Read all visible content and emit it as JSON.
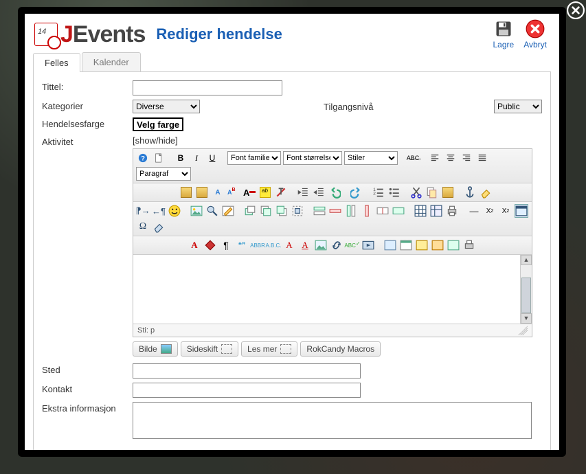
{
  "logo": {
    "j": "J",
    "rest": "Events"
  },
  "page_title": "Rediger hendelse",
  "header_actions": {
    "save": "Lagre",
    "cancel": "Avbryt"
  },
  "tabs": {
    "common": "Felles",
    "calendar": "Kalender"
  },
  "labels": {
    "title": "Tittel:",
    "categories": "Kategorier",
    "access": "Tilgangsnivå",
    "eventcolor": "Hendelsesfarge",
    "activity": "Aktivitet",
    "showhide": "[show/hide]",
    "place": "Sted",
    "contact": "Kontakt",
    "extra": "Ekstra informasjon"
  },
  "selects": {
    "category": "Diverse",
    "access": "Public",
    "fontfamily": "Font familie",
    "fontsize": "Font størrelse",
    "styles": "Stiler",
    "paragraph": "Paragraf"
  },
  "buttons": {
    "pick_color": "Velg farge",
    "image": "Bilde",
    "pagebreak": "Sideskift",
    "readmore": "Les mer",
    "rokcandy": "RokCandy Macros"
  },
  "editor_path": "Sti: p",
  "icons": {
    "help": "help-icon",
    "newdoc": "newdoc-icon",
    "bold": "bold-icon",
    "italic": "italic-icon",
    "underline": "underline-icon",
    "strike": "strike-icon",
    "alignl": "align-left-icon",
    "alignc": "align-center-icon",
    "alignr": "align-right-icon",
    "alignj": "align-justify-icon",
    "paste": "paste-icon",
    "pasteword": "paste-word-icon",
    "find": "find-icon",
    "replace": "replace-icon",
    "color": "text-color-icon",
    "hilite": "highlight-icon",
    "clean": "remove-format-icon",
    "outdent": "outdent-icon",
    "indent": "indent-icon",
    "undo": "undo-icon",
    "redo": "redo-icon",
    "ol": "ordered-list-icon",
    "ul": "unordered-list-icon",
    "cut": "cut-icon",
    "copy": "copy-icon",
    "paste2": "paste-plain-icon",
    "anchor": "anchor-icon",
    "eraser": "eraser-icon",
    "ltr": "ltr-icon",
    "rtl": "rtl-icon",
    "emoji": "emoji-icon",
    "image": "image-icon",
    "zoom": "zoom-icon",
    "edit": "edit-html-icon",
    "layer": "layer-icon",
    "forward": "move-forward-icon",
    "back": "move-back-icon",
    "abspos": "abs-position-icon",
    "inserttable": "table-insert-icon",
    "tableprops": "table-props-icon",
    "print": "print-icon",
    "hr": "horizontal-rule-icon",
    "sub": "subscript-icon",
    "sup": "superscript-icon",
    "date": "date-icon",
    "omega": "special-char-icon",
    "wand": "cleanup-icon",
    "fonta": "font-a-icon",
    "diamond": "diamond-icon",
    "pilcrow": "pilcrow-icon",
    "quote": "blockquote-icon",
    "abbr": "abbr-icon",
    "acronym": "acronym-icon",
    "reda": "style-a-icon",
    "ared": "style-a2-icon",
    "img2": "image2-icon",
    "link": "link-icon",
    "spell": "spellcheck-icon",
    "media": "media-icon",
    "flash": "flash-icon",
    "movie": "movie-icon",
    "audio": "audio-icon",
    "embed": "embed-icon",
    "source": "source-icon",
    "preview": "preview-icon"
  }
}
